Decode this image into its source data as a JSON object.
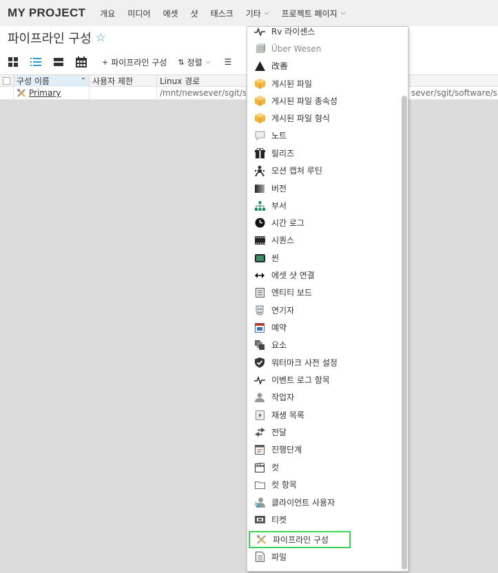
{
  "nav": {
    "brand": "MY PROJECT",
    "items": [
      "개요",
      "미디어",
      "에셋",
      "샷",
      "태스크",
      "기타",
      "프로젝트 페이지"
    ]
  },
  "page": {
    "title": "파이프라인 구성"
  },
  "toolbar": {
    "add_label": "파이프라인 구성",
    "sort_label": "정렬"
  },
  "table": {
    "columns": [
      "구성 이름",
      "사용자 제한",
      "Linux 경로"
    ],
    "rows": [
      {
        "name": "Primary",
        "limit": "",
        "linux_path": "/mnt/newsever/sgit/so",
        "path2": "sever/sgit/software/sho"
      }
    ]
  },
  "menu": {
    "items": [
      {
        "label": "Rv 라이센스",
        "icon": "pulse-icon"
      },
      {
        "label": "Über Wesen",
        "icon": "cube-gray-icon"
      },
      {
        "label": "改善",
        "icon": "triangle-icon"
      },
      {
        "label": "게시된 파일",
        "icon": "package-icon"
      },
      {
        "label": "게시된 파일 종속성",
        "icon": "package-icon"
      },
      {
        "label": "게시된 파일 형식",
        "icon": "package-icon"
      },
      {
        "label": "노트",
        "icon": "speech-bubble-icon"
      },
      {
        "label": "릴리즈",
        "icon": "gift-icon"
      },
      {
        "label": "모션 캡처 루틴",
        "icon": "mocap-figure-icon"
      },
      {
        "label": "버전",
        "icon": "version-square-icon"
      },
      {
        "label": "부서",
        "icon": "org-tree-icon"
      },
      {
        "label": "시간 로그",
        "icon": "clock-icon"
      },
      {
        "label": "시퀀스",
        "icon": "filmstrip-icon"
      },
      {
        "label": "씬",
        "icon": "scene-film-icon"
      },
      {
        "label": "에셋 샷 연결",
        "icon": "double-arrow-icon"
      },
      {
        "label": "엔티티 보드",
        "icon": "board-icon"
      },
      {
        "label": "연기자",
        "icon": "performer-icon"
      },
      {
        "label": "예약",
        "icon": "calendar-icon"
      },
      {
        "label": "요소",
        "icon": "elements-icon"
      },
      {
        "label": "워터마크 사전 설정",
        "icon": "shield-check-icon"
      },
      {
        "label": "이벤트 로그 항목",
        "icon": "pulse-icon"
      },
      {
        "label": "작업자",
        "icon": "person-icon"
      },
      {
        "label": "재생 목록",
        "icon": "playlist-icon"
      },
      {
        "label": "전달",
        "icon": "transfer-arrows-icon"
      },
      {
        "label": "진행단계",
        "icon": "phase-icon"
      },
      {
        "label": "컷",
        "icon": "clapper-icon"
      },
      {
        "label": "컷 항목",
        "icon": "folder-icon"
      },
      {
        "label": "클라이언트 사용자",
        "icon": "client-user-icon"
      },
      {
        "label": "티켓",
        "icon": "ticket-icon"
      },
      {
        "label": "파이프라인 구성",
        "icon": "tools-icon"
      },
      {
        "label": "파일",
        "icon": "file-icon"
      }
    ]
  },
  "colors": {
    "accent": "#2b9ccf",
    "highlight": "#39d353"
  }
}
